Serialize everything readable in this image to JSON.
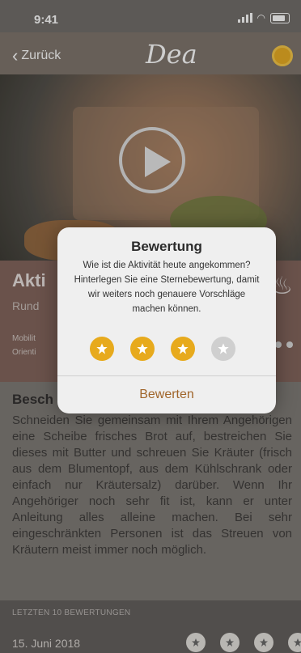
{
  "status": {
    "time": "9:41"
  },
  "header": {
    "back_label": "Zurück",
    "logo": "Dea"
  },
  "activity": {
    "title_visible": "Akti",
    "subtitle_visible": "Rund",
    "tags_visible": [
      "Mobilit",
      "Orienti"
    ]
  },
  "description": {
    "heading_visible": "Besch",
    "text": "Schneiden Sie gemeinsam mit Ihrem Angehörigen eine Scheibe frisches Brot auf, bestreichen Sie dieses mit Butter und schreuen Sie Kräuter (frisch aus dem Blumentopf, aus dem Kühlschrank oder einfach nur Kräutersalz) darüber. Wenn Ihr Angehöriger noch sehr fit ist, kann er unter Anleitung alles alleine machen. Bei sehr eingeschränkten Personen ist das Streuen von Kräutern meist immer noch möglich."
  },
  "ratings": {
    "heading": "LETZTEN 10 BEWERTUNGEN",
    "rows": [
      {
        "date": "15. Juni 2018"
      }
    ]
  },
  "modal": {
    "title": "Bewertung",
    "message": "Wie ist die Aktivität heute angekommen? Hinterlegen Sie eine Sternebewertung, damit wir weiters noch genauere Vorschläge machen können.",
    "rating_selected": 3,
    "rating_max": 4,
    "button_label": "Bewerten"
  },
  "colors": {
    "accent": "#e7aa1d",
    "button_text": "#a0652a",
    "star_inactive": "#cfcfcf"
  },
  "icons": [
    "back-chevron-icon",
    "profile-icon",
    "play-icon",
    "pot-icon",
    "star-icon"
  ]
}
